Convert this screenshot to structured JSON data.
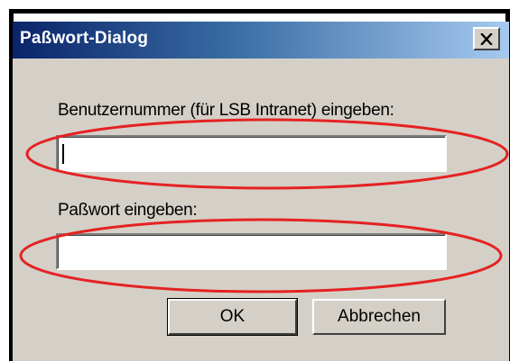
{
  "window": {
    "title": "Paßwort-Dialog",
    "close_glyph": "×"
  },
  "form": {
    "user_label": "Benutzernummer (für LSB Intranet) eingeben:",
    "user_value": "",
    "password_label": "Paßwort eingeben:",
    "password_value": ""
  },
  "buttons": {
    "ok_label": "OK",
    "cancel_label": "Abbrechen"
  },
  "annotations": {
    "highlight_color": "#e52222",
    "highlighted": [
      "user-input-field",
      "password-input-field"
    ]
  },
  "colors": {
    "dialog_face": "#d4d0c8",
    "title_start": "#0a246a",
    "title_end": "#a6caf0"
  }
}
